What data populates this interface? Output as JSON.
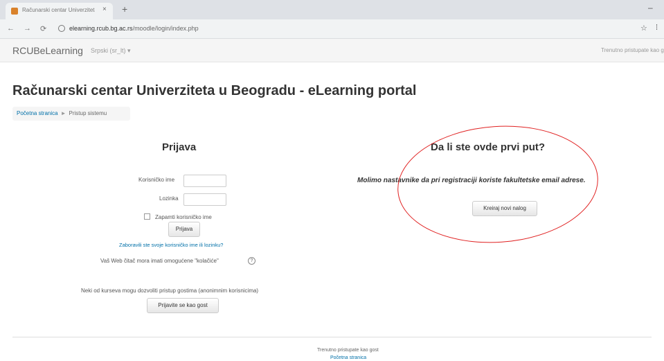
{
  "browser": {
    "tab_title": "Računarski centar Univerziteta u ...",
    "tab_close": "×",
    "new_tab": "+",
    "url_host": "elearning.rcub.bg.ac.rs",
    "url_path": "/moodle/login/index.php"
  },
  "navbar": {
    "brand": "RCUBeLearning",
    "language": "Srpski (sr_lt) ▾",
    "login_status": "Trenutno pristupate kao gost"
  },
  "page": {
    "title": "Računarski centar Univerziteta u Beogradu - eLearning portal",
    "breadcrumb": [
      "Početna stranica",
      "Pristup sistemu"
    ],
    "breadcrumb_sep": "►"
  },
  "login": {
    "heading": "Prijava",
    "username_label": "Korisničko ime",
    "password_label": "Lozinka",
    "remember_label": "Zapamti korisničko ime",
    "login_button": "Prijava",
    "forgot_link": "Zaboravili ste svoje korisničko ime ili lozinku?",
    "cookies_note": "Vaš Web čitač mora imati omogućene \"kolačiće\"",
    "guest_note": "Neki od kurseva mogu dozvoliti pristup gostima (anonimnim korisnicima)",
    "guest_button": "Prijavite se kao gost"
  },
  "signup": {
    "heading": "Da li ste ovde prvi put?",
    "text": "Molimo nastavnike da pri registraciji koriste fakultetske email adrese.",
    "button": "Kreiraj novi nalog"
  },
  "footer": {
    "status": "Trenutno pristupate kao gost",
    "link": "Početna stranica"
  },
  "colors": {
    "link": "#0070a8",
    "annotation": "#e02020"
  }
}
